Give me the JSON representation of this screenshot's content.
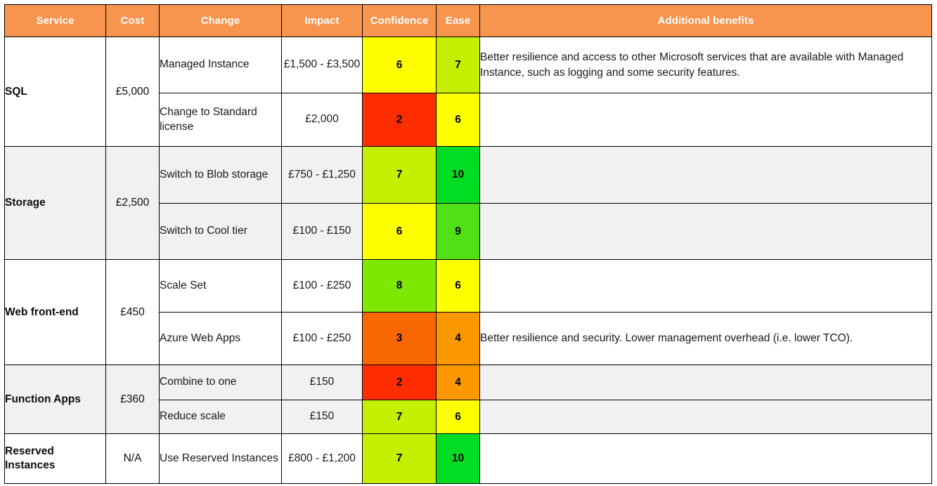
{
  "table": {
    "headers": [
      {
        "key": "service",
        "label": "Service"
      },
      {
        "key": "cost",
        "label": "Cost"
      },
      {
        "key": "change",
        "label": "Change"
      },
      {
        "key": "impact",
        "label": "Impact"
      },
      {
        "key": "confidence",
        "label": "Confidence"
      },
      {
        "key": "ease",
        "label": "Ease"
      },
      {
        "key": "benefits",
        "label": "Additional benefits"
      }
    ],
    "header_bg": "#F7944D",
    "header_text_color": "#FFFFFF",
    "band_bg": "#F1F1F1",
    "score_colors": {
      "2": "#FF2D00",
      "3": "#F96800",
      "4": "#FB9800",
      "6": "#FFFF00",
      "7": "#C4F000",
      "8": "#7FE800",
      "9": "#4FE015",
      "10": "#00DD22"
    },
    "sections": [
      {
        "service": "SQL",
        "cost": "£5,000",
        "banded": false,
        "rows": [
          {
            "change": "Managed Instance",
            "impact": "£1,500 - £3,500",
            "confidence": "6",
            "ease": "7",
            "benefits": "Better resilience and access to other Microsoft services that are available with Managed Instance, such as logging and some security features."
          },
          {
            "change": "Change to Standard license",
            "impact": "£2,000",
            "confidence": "2",
            "ease": "6",
            "benefits": ""
          }
        ]
      },
      {
        "service": "Storage",
        "cost": "£2,500",
        "banded": true,
        "rows": [
          {
            "change": "Switch to Blob storage",
            "impact": "£750 - £1,250",
            "confidence": "7",
            "ease": "10",
            "benefits": ""
          },
          {
            "change": "Switch to Cool tier",
            "impact": "£100 - £150",
            "confidence": "6",
            "ease": "9",
            "benefits": ""
          }
        ]
      },
      {
        "service": "Web front-end",
        "cost": "£450",
        "banded": false,
        "rows": [
          {
            "change": "Scale Set",
            "impact": "£100 - £250",
            "confidence": "8",
            "ease": "6",
            "benefits": ""
          },
          {
            "change": "Azure Web Apps",
            "impact": "£100 - £250",
            "confidence": "3",
            "ease": "4",
            "benefits": "Better resilience and security. Lower management overhead (i.e. lower TCO)."
          }
        ]
      },
      {
        "service": "Function Apps",
        "cost": "£360",
        "banded": true,
        "rows": [
          {
            "change": "Combine to one",
            "impact": "£150",
            "confidence": "2",
            "ease": "4",
            "benefits": ""
          },
          {
            "change": "Reduce scale",
            "impact": "£150",
            "confidence": "7",
            "ease": "6",
            "benefits": ""
          }
        ]
      },
      {
        "service": "Reserved Instances",
        "cost": "N/A",
        "banded": false,
        "rows": [
          {
            "change": "Use Reserved Instances",
            "impact": "£800 - £1,200",
            "confidence": "7",
            "ease": "10",
            "benefits": ""
          }
        ]
      }
    ]
  }
}
